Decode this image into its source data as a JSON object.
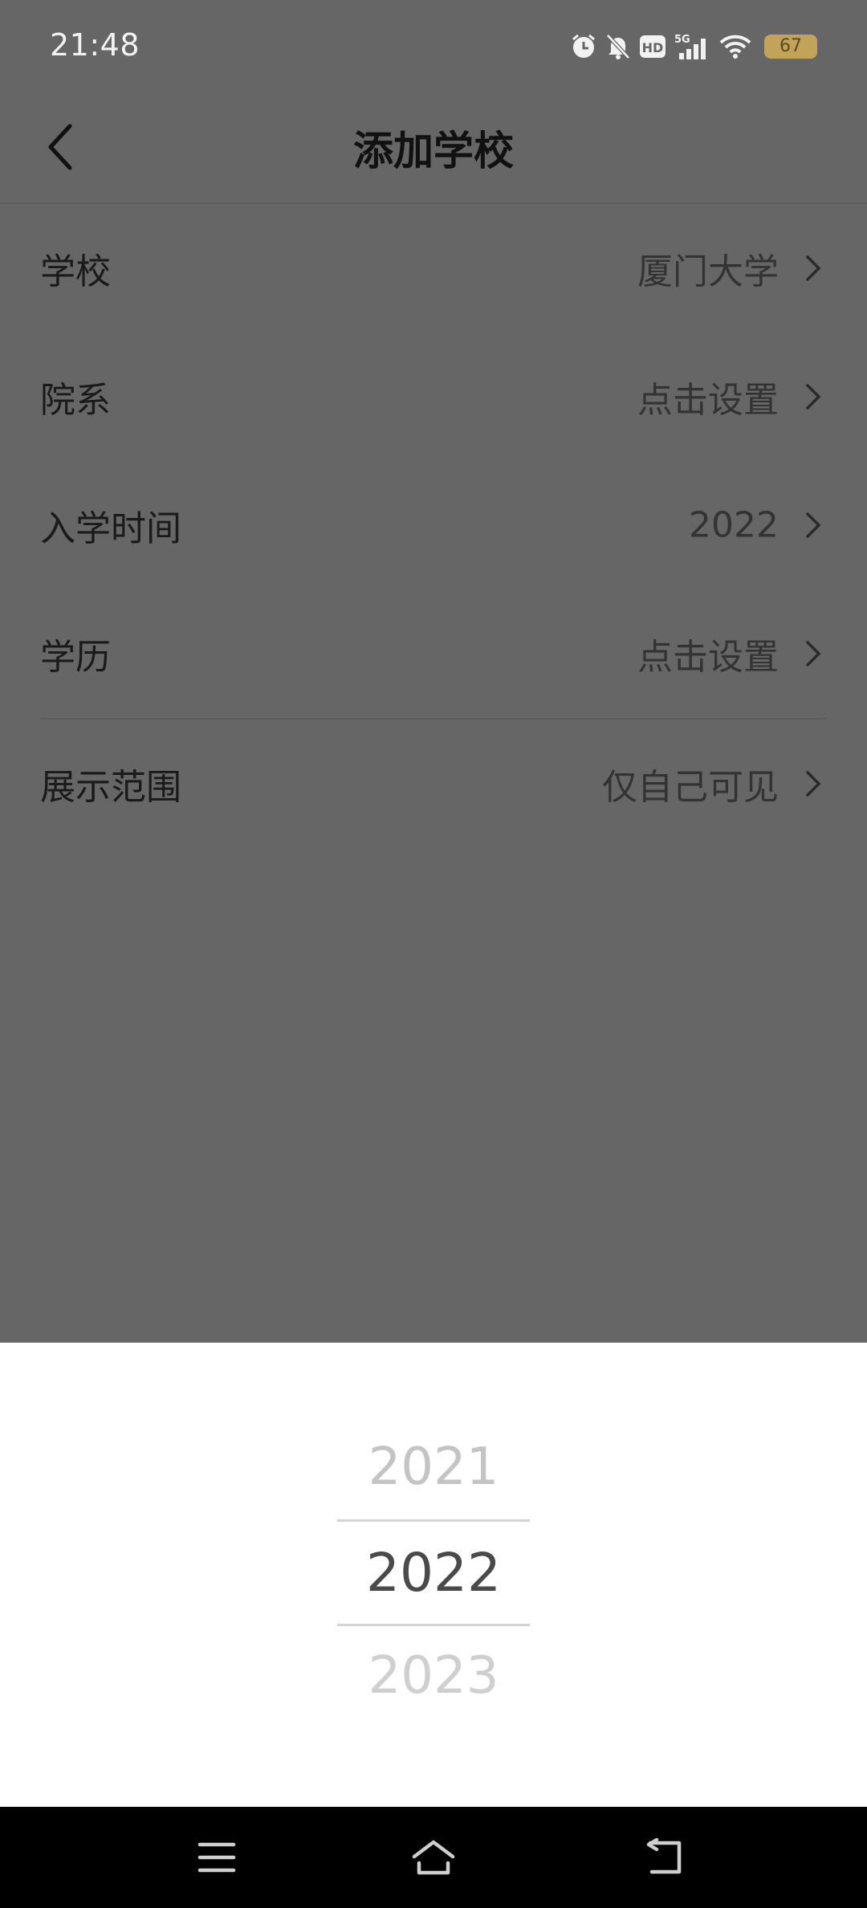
{
  "status_bar": {
    "time": "21:48",
    "icons": [
      "alarm-icon",
      "mute-bell-icon",
      "hd-icon",
      "5g-signal-icon",
      "wifi-icon"
    ],
    "network": "5G",
    "hd_label": "HD",
    "battery": "67"
  },
  "header": {
    "title": "添加学校"
  },
  "form": {
    "rows": [
      {
        "label": "学校",
        "value": "厦门大学"
      },
      {
        "label": "院系",
        "value": "点击设置"
      },
      {
        "label": "入学时间",
        "value": "2022"
      },
      {
        "label": "学历",
        "value": "点击设置"
      },
      {
        "label": "展示范围",
        "value": "仅自己可见"
      }
    ]
  },
  "picker": {
    "previous": "2021",
    "selected": "2022",
    "next": "2023"
  },
  "colors": {
    "overlay_bg": "#666666",
    "sheet_bg": "#ffffff",
    "battery": "#c2a35a",
    "navbar_bg": "#000000"
  }
}
